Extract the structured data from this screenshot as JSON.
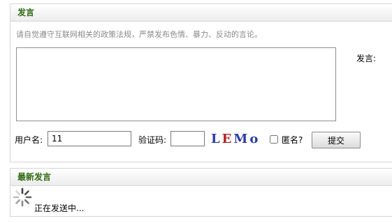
{
  "post_panel": {
    "title": "发言",
    "notice": "请自觉遵守互联网相关的政策法规，严禁发布色情、暴力、反动的言论。",
    "content_value": "",
    "side_label": "发言:",
    "username_label": "用户名:",
    "username_value": "11",
    "captcha_label": "验证码:",
    "captcha_value": "",
    "captcha_text": {
      "part1": "L",
      "part2": "E",
      "part3": "Mo"
    },
    "anonymous_label": "匿名?",
    "anonymous_checked": false,
    "submit_label": "提交"
  },
  "latest_panel": {
    "title": "最新发言",
    "status_text": "正在发送中..."
  },
  "icons": {
    "spinner": "loading-spinner-icon"
  }
}
